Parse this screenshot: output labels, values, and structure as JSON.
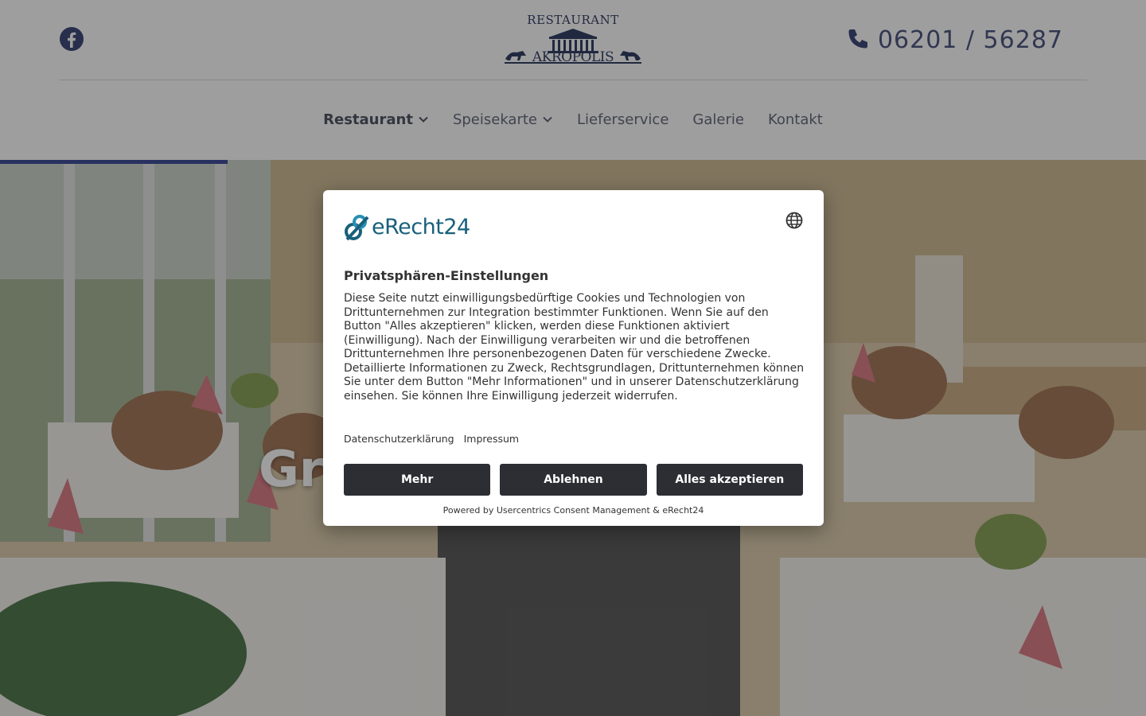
{
  "header": {
    "logo_top": "RESTAURANT",
    "logo_name": "AKROPOLIS",
    "phone": "06201 / 56287",
    "social_icon": "facebook-icon",
    "phone_icon": "phone-icon"
  },
  "nav": {
    "items": [
      {
        "label": "Restaurant",
        "dropdown": true,
        "active": true
      },
      {
        "label": "Speisekarte",
        "dropdown": true,
        "active": false
      },
      {
        "label": "Lieferservice",
        "dropdown": false,
        "active": false
      },
      {
        "label": "Galerie",
        "dropdown": false,
        "active": false
      },
      {
        "label": "Kontakt",
        "dropdown": false,
        "active": false
      }
    ]
  },
  "hero": {
    "heading_visible": "Gr"
  },
  "consent": {
    "brand": "eRecht24",
    "language_icon": "globe-icon",
    "title": "Privatsphären-Einstellungen",
    "body": "Diese Seite nutzt einwilligungsbedürftige Cookies und Technologien von Drittunternehmen zur Integration bestimmter Funktionen. Wenn Sie auf den Button \"Alles akzeptieren\" klicken, werden diese Funktionen aktiviert (Einwilligung). Nach der Einwilligung verarbeiten wir und die betroffenen Drittunternehmen Ihre personenbezogenen Daten für verschiedene Zwecke. Detaillierte Informationen zu Zweck, Rechtsgrundlagen, Drittunternehmen können Sie unter dem Button \"Mehr Informationen\" und in unserer Datenschutzerklärung einsehen. Sie können Ihre Einwilligung jederzeit widerrufen.",
    "link_privacy": "Datenschutzerklärung",
    "link_imprint": "Impressum",
    "btn_more": "Mehr",
    "btn_decline": "Ablehnen",
    "btn_accept": "Alles akzeptieren",
    "powered_by": "Powered by Usercentrics Consent Management & eRecht24"
  },
  "colors": {
    "brand_navy": "#2b3a8f",
    "button_dark": "#2c2e33",
    "erecht_teal": "#19607b"
  }
}
